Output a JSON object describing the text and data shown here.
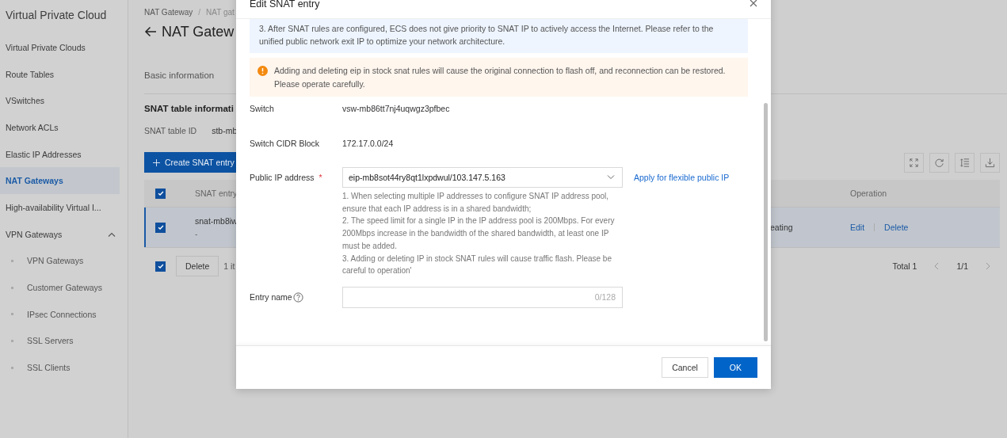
{
  "sidebar": {
    "title": "Virtual Private Cloud",
    "items": [
      {
        "label": "Virtual Private Clouds",
        "selected": false
      },
      {
        "label": "Route Tables",
        "selected": false
      },
      {
        "label": "VSwitches",
        "selected": false
      },
      {
        "label": "Network ACLs",
        "selected": false
      },
      {
        "label": "Elastic IP Addresses",
        "selected": false
      },
      {
        "label": "NAT Gateways",
        "selected": true
      },
      {
        "label": "High-availability Virtual I...",
        "selected": false
      },
      {
        "label": "VPN Gateways",
        "selected": false,
        "expanded": true,
        "children": [
          {
            "label": "VPN Gateways",
            "selected": false
          },
          {
            "label": "Customer Gateways",
            "selected": false
          },
          {
            "label": "IPsec Connections",
            "selected": false
          },
          {
            "label": "SSL Servers",
            "selected": false
          },
          {
            "label": "SSL Clients",
            "selected": false
          }
        ]
      }
    ]
  },
  "page": {
    "breadcrumb": [
      "NAT Gateway",
      "NAT gat"
    ],
    "breadcrumb_separator": "/",
    "title": "NAT Gatew",
    "tabs": [
      {
        "label": "Basic information",
        "selected": false
      }
    ],
    "section_title": "SNAT table informati",
    "table_id": {
      "label": "SNAT table ID",
      "value": "stb-mb"
    },
    "create_button": "Create SNAT entry",
    "table": {
      "select_all": true,
      "columns": [
        "SNAT entry",
        "Operation"
      ],
      "rows": [
        {
          "checked": true,
          "selected": true,
          "entry": "snat-mb8iw",
          "entry_note": "-",
          "column_3": "eating",
          "actions": [
            "Edit",
            "Delete"
          ]
        }
      ]
    },
    "footer": {
      "checked": true,
      "delete_button": "Delete",
      "count": "1 it",
      "total": "Total 1",
      "page": "1/1"
    }
  },
  "dialog": {
    "title": "Edit SNAT entry",
    "info": "3. After SNAT rules are configured, ECS does not give priority to SNAT IP to actively access the Internet. Please refer to the unified public network exit IP to optimize your network architecture.",
    "warning": "Adding and deleting eip in stock snat rules will cause the original connection to flash off, and reconnection can be restored. Please operate carefully.",
    "fields": [
      {
        "kind": "text",
        "label": "Switch",
        "value": "vsw-mb86tt7nj4uqwgz3pfbec"
      },
      {
        "kind": "text",
        "label": "Switch CIDR Block",
        "value": "172.17.0.0/24"
      },
      {
        "kind": "select",
        "label": "Public IP address",
        "required_mark": "*",
        "value": "eip-mb8sot44ry8qt1lxpdwul/103.147.5.163",
        "link": "Apply for flexible public IP",
        "help": [
          "1. When selecting multiple IP addresses to configure SNAT IP address pool, ensure that each IP address is in a shared bandwidth;",
          "2. The speed limit for a single IP in the IP address pool is 200Mbps. For every 200Mbps increase in the bandwidth of the shared bandwidth, at least one IP must be added.",
          "3. Adding or deleting IP in stock SNAT rules will cause traffic flash. Please be careful to operation'"
        ]
      },
      {
        "kind": "input",
        "label": "Entry name",
        "counter": "0/128"
      }
    ],
    "buttons": [
      {
        "label": "Cancel",
        "kind": "secondary"
      },
      {
        "label": "OK",
        "kind": "primary"
      }
    ]
  }
}
